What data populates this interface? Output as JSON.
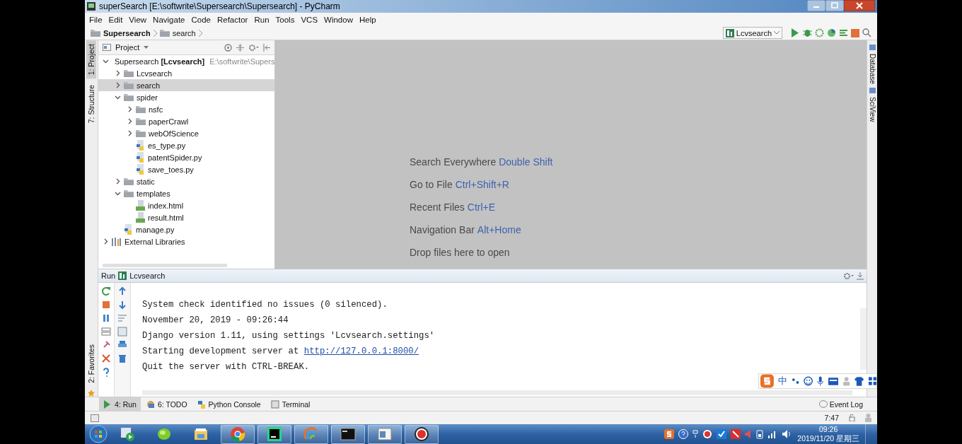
{
  "window": {
    "title": "superSearch [E:\\softwrite\\Supersearch\\Supersearch] - PyCharm"
  },
  "menu": [
    "File",
    "Edit",
    "View",
    "Navigate",
    "Code",
    "Refactor",
    "Run",
    "Tools",
    "VCS",
    "Window",
    "Help"
  ],
  "breadcrumbs": [
    "Supersearch",
    "search"
  ],
  "run_config": "Lcvsearch",
  "left_stripe": [
    {
      "label": "1: Project",
      "selected": true
    },
    {
      "label": "7: Structure",
      "selected": false
    }
  ],
  "left_stripe_bottom": [
    {
      "label": "2: Favorites",
      "selected": false
    }
  ],
  "right_stripe": [
    "Database",
    "SciView"
  ],
  "project": {
    "title": "Project",
    "tree": [
      {
        "kind": "folder",
        "label": "Supersearch **[Lcvsearch]**",
        "path": "E:\\softwrite\\Supers",
        "expanded": true,
        "selected": false,
        "children": [
          {
            "kind": "folder",
            "label": "Lcvsearch",
            "expanded": false,
            "selected": false
          },
          {
            "kind": "folder",
            "label": "search",
            "expanded": false,
            "selected": true
          },
          {
            "kind": "folder",
            "label": "spider",
            "expanded": true,
            "selected": false,
            "children": [
              {
                "kind": "folder",
                "label": "nsfc",
                "expanded": false,
                "selected": false
              },
              {
                "kind": "folder",
                "label": "paperCrawl",
                "expanded": false,
                "selected": false
              },
              {
                "kind": "folder",
                "label": "webOfScience",
                "expanded": false,
                "selected": false
              },
              {
                "kind": "python",
                "label": "es_type.py",
                "selected": false
              },
              {
                "kind": "python",
                "label": "patentSpider.py",
                "selected": false
              },
              {
                "kind": "python",
                "label": "save_toes.py",
                "selected": false
              }
            ]
          },
          {
            "kind": "folder",
            "label": "static",
            "expanded": false,
            "selected": false
          },
          {
            "kind": "folder",
            "label": "templates",
            "expanded": true,
            "selected": false,
            "children": [
              {
                "kind": "html",
                "label": "index.html",
                "selected": false
              },
              {
                "kind": "html",
                "label": "result.html",
                "selected": false
              }
            ]
          },
          {
            "kind": "python",
            "label": "manage.py",
            "selected": false
          }
        ]
      },
      {
        "kind": "library",
        "label": "External Libraries",
        "expanded": false,
        "selected": false
      }
    ]
  },
  "editor_hints": [
    {
      "label": "Search Everywhere",
      "shortcut": "Double Shift"
    },
    {
      "label": "Go to File",
      "shortcut": "Ctrl+Shift+R"
    },
    {
      "label": "Recent Files",
      "shortcut": "Ctrl+E"
    },
    {
      "label": "Navigation Bar",
      "shortcut": "Alt+Home"
    },
    {
      "label": "Drop files here to open"
    }
  ],
  "run": {
    "title": "Run",
    "config": "Lcvsearch",
    "lines": [
      {
        "text": "System check identified no issues (0 silenced)."
      },
      {
        "text": "November 20, 2019 - 09:26:44"
      },
      {
        "text": "Django version 1.11, using settings 'Lcvsearch.settings'"
      },
      {
        "text": "Starting development server at ",
        "link": "http://127.0.0.1:8000/"
      },
      {
        "text": "Quit the server with CTRL-BREAK."
      }
    ]
  },
  "bottom_tabs": [
    {
      "label": "4: Run",
      "selected": true,
      "kind": "run"
    },
    {
      "label": "6: TODO",
      "selected": false,
      "kind": "todo"
    },
    {
      "label": "Python Console",
      "selected": false,
      "kind": "python"
    },
    {
      "label": "Terminal",
      "selected": false,
      "kind": "terminal"
    }
  ],
  "event_log": "Event Log",
  "status": {
    "position": "7:47"
  },
  "ime": {
    "mode": "中"
  },
  "taskbar": {
    "apps": [
      {
        "kind": "media",
        "running": false
      },
      {
        "kind": "leaf",
        "running": false
      },
      {
        "kind": "explorer",
        "running": false
      },
      {
        "kind": "chrome",
        "running": true
      },
      {
        "kind": "pycharm",
        "running": true
      },
      {
        "kind": "swirl",
        "running": true
      },
      {
        "kind": "cmd",
        "running": true
      },
      {
        "kind": "window",
        "running": true
      },
      {
        "kind": "record",
        "running": true
      }
    ],
    "clock": {
      "time": "09:26",
      "date": "2019/11/20 星期三"
    }
  }
}
